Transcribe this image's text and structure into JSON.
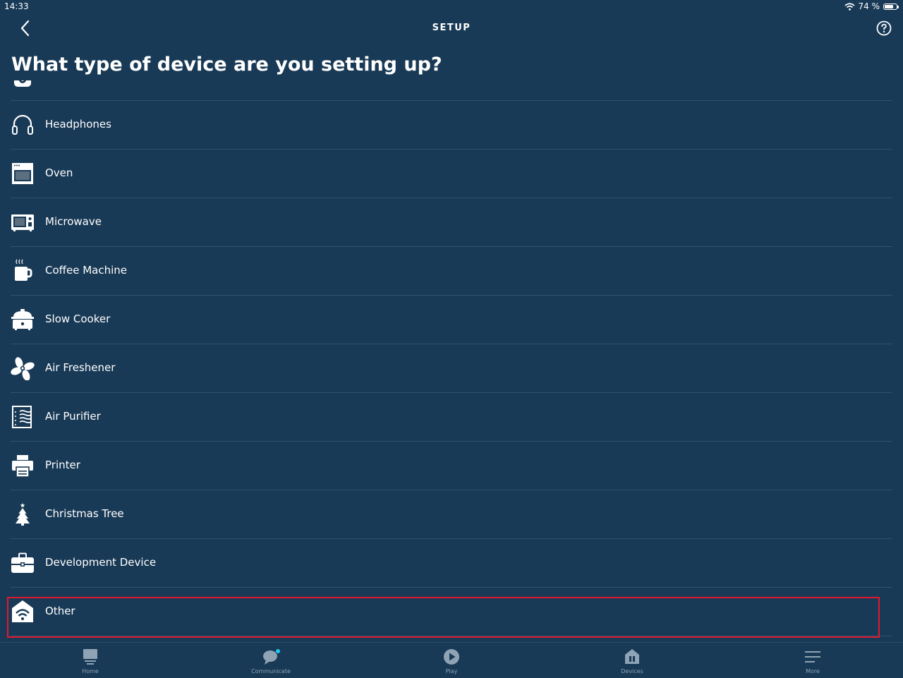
{
  "status": {
    "time": "14:33",
    "battery_text": "74 %",
    "battery_level": 0.74
  },
  "header": {
    "title": "SETUP"
  },
  "page": {
    "title": "What type of device are you setting up?"
  },
  "devices": [
    {
      "label": "",
      "icon": "speaker-icon"
    },
    {
      "label": "Headphones",
      "icon": "headphones-icon"
    },
    {
      "label": "Oven",
      "icon": "oven-icon"
    },
    {
      "label": "Microwave",
      "icon": "microwave-icon"
    },
    {
      "label": "Coffee Machine",
      "icon": "coffee-machine-icon"
    },
    {
      "label": "Slow Cooker",
      "icon": "slow-cooker-icon"
    },
    {
      "label": "Air Freshener",
      "icon": "fan-icon"
    },
    {
      "label": "Air Purifier",
      "icon": "air-purifier-icon"
    },
    {
      "label": "Printer",
      "icon": "printer-icon"
    },
    {
      "label": "Christmas Tree",
      "icon": "christmas-tree-icon"
    },
    {
      "label": "Development Device",
      "icon": "toolbox-icon"
    },
    {
      "label": "Other",
      "icon": "wifi-house-icon"
    }
  ],
  "highlight_color": "#e0182d",
  "tabs": [
    {
      "label": "Home",
      "icon": "home-icon"
    },
    {
      "label": "Communicate",
      "icon": "chat-bubble-icon"
    },
    {
      "label": "Play",
      "icon": "play-icon"
    },
    {
      "label": "Devices",
      "icon": "devices-icon"
    },
    {
      "label": "More",
      "icon": "menu-icon"
    }
  ]
}
